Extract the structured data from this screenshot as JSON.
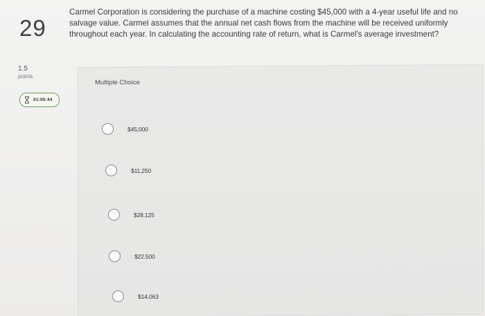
{
  "question": {
    "number": "29",
    "text": "Carmel Corporation is considering the purchase of a machine costing $45,000 with a 4-year useful life and no salvage value. Carmel assumes that the annual net cash flows from the machine will be received uniformly throughout each year. In calculating the accounting rate of return, what is Carmel's average investment?",
    "points_value": "1.5",
    "points_label": "points"
  },
  "timer": {
    "icon": "hourglass-icon",
    "value": "01:05:44",
    "border_color": "#6d9d5f"
  },
  "answer": {
    "type_label": "Multiple Choice",
    "options": [
      {
        "label": "$45,000",
        "selected": false
      },
      {
        "label": "$11,250",
        "selected": false
      },
      {
        "label": "$28,125",
        "selected": false
      },
      {
        "label": "$22,500",
        "selected": false
      },
      {
        "label": "$14,063",
        "selected": false
      }
    ]
  }
}
